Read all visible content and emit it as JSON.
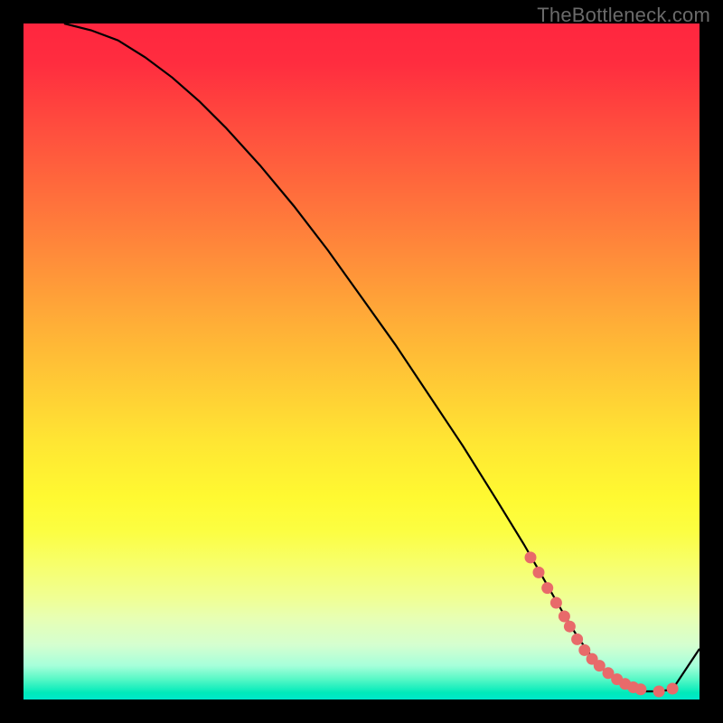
{
  "watermark": "TheBottleneck.com",
  "chart_data": {
    "type": "line",
    "title": "",
    "xlabel": "",
    "ylabel": "",
    "xlim": [
      0,
      100
    ],
    "ylim": [
      0,
      100
    ],
    "curve": {
      "x": [
        6,
        10,
        14,
        18,
        22,
        26,
        30,
        35,
        40,
        45,
        50,
        55,
        60,
        65,
        70,
        74,
        76,
        78,
        80,
        82,
        84,
        86,
        88,
        90,
        92,
        94,
        96,
        100
      ],
      "y": [
        100,
        99,
        97.5,
        95,
        92,
        88.5,
        84.5,
        79,
        73,
        66.5,
        59.5,
        52.5,
        45,
        37.5,
        29.5,
        23,
        19.5,
        16,
        12.5,
        9.2,
        6.4,
        4.2,
        2.6,
        1.6,
        1.2,
        1.2,
        1.5,
        7.5
      ]
    },
    "highlight_points": {
      "x": [
        75.0,
        76.2,
        77.5,
        78.8,
        80.0,
        80.8,
        81.9,
        83.0,
        84.1,
        85.2,
        86.5,
        87.8,
        89.0,
        90.2,
        91.3,
        94.0,
        96.0
      ],
      "y": [
        21.0,
        18.8,
        16.5,
        14.3,
        12.3,
        10.8,
        8.9,
        7.3,
        6.0,
        5.0,
        3.9,
        3.0,
        2.3,
        1.8,
        1.5,
        1.2,
        1.6
      ]
    },
    "gradient_stops": [
      {
        "pos": 0.0,
        "color": "#ff263f"
      },
      {
        "pos": 0.3,
        "color": "#ff7d3b"
      },
      {
        "pos": 0.62,
        "color": "#ffe633"
      },
      {
        "pos": 0.85,
        "color": "#f0ff94"
      },
      {
        "pos": 1.0,
        "color": "#00e8cb"
      }
    ]
  }
}
